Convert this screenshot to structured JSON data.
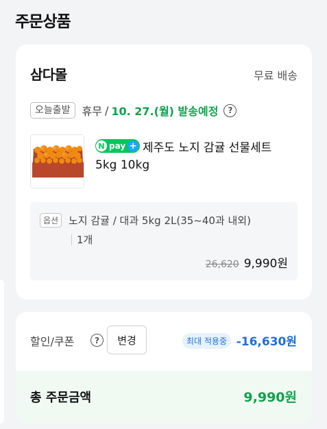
{
  "section_title": "주문상품",
  "order": {
    "store_name": "삼다몰",
    "shipping_fee": "무료 배송",
    "today_badge": "오늘출발",
    "holiday": "휴무",
    "slash": "/",
    "ship_date": "10. 27.(월) 발송예정",
    "help_icon": "?",
    "npay": {
      "n": "N",
      "text": "pay",
      "plus": "+"
    },
    "product_name_line1": "제주도 노지 감귤 선물세트",
    "product_name_line2": "5kg 10kg",
    "option_badge": "옵션",
    "option_text": "노지 감귤 / 대과 5kg 2L(35~40과 내외)",
    "quantity": "1개",
    "original_price": "26,620",
    "price": "9,990원"
  },
  "discount": {
    "label": "할인/쿠폰",
    "help_icon": "?",
    "change_button": "변경",
    "max_badge": "최대 적용중",
    "amount": "-16,630원"
  },
  "total": {
    "label": "총 주문금액",
    "amount": "9,990원"
  },
  "colors": {
    "green": "#10a24b",
    "npay_green": "#03c75a",
    "blue": "#1e6fd9"
  }
}
